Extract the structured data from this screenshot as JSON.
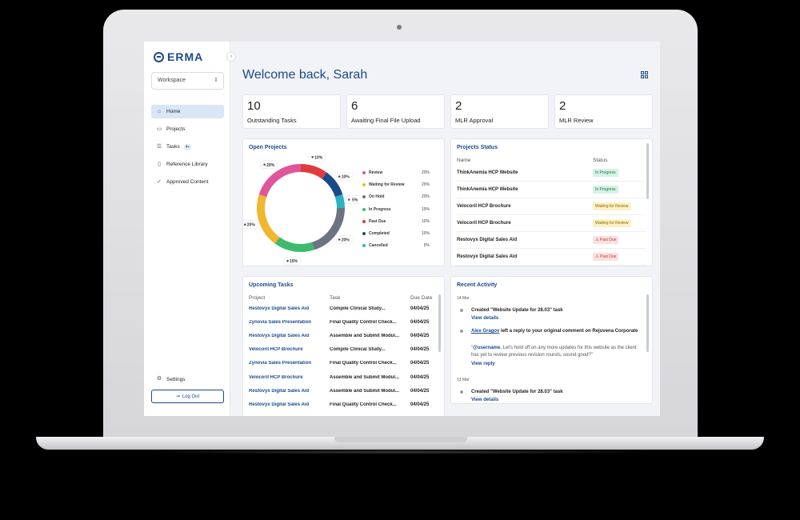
{
  "app": {
    "logo": "ERMA"
  },
  "sidebar": {
    "workspace_placeholder": "Workspace",
    "items": [
      {
        "label": "Home",
        "icon": "home-icon"
      },
      {
        "label": "Projects",
        "icon": "folder-icon"
      },
      {
        "label": "Tasks",
        "icon": "tasks-icon",
        "badge": "4+"
      },
      {
        "label": "Reference Library",
        "icon": "book-icon"
      },
      {
        "label": "Approved Content",
        "icon": "check-icon"
      }
    ],
    "settings_label": "Settings",
    "logout_label": "Log Out"
  },
  "header": {
    "welcome": "Welcome back, Sarah"
  },
  "stats": [
    {
      "value": "10",
      "label": "Outstanding Tasks"
    },
    {
      "value": "6",
      "label": "Awaiting Final File Upload"
    },
    {
      "value": "2",
      "label": "MLR Approval"
    },
    {
      "value": "2",
      "label": "MLR Review"
    }
  ],
  "open_projects": {
    "title": "Open Projects",
    "segments": [
      {
        "label": "Review",
        "value": 20,
        "pct": "20%",
        "color": "#e0569a"
      },
      {
        "label": "Waiting for Review",
        "value": 20,
        "pct": "20%",
        "color": "#f0b72f"
      },
      {
        "label": "On Hold",
        "value": 20,
        "pct": "20%",
        "color": "#6d7481"
      },
      {
        "label": "In Progress",
        "value": 15,
        "pct": "15%",
        "color": "#3dbb6b"
      },
      {
        "label": "Past Due",
        "value": 10,
        "pct": "10%",
        "color": "#e23b3b"
      },
      {
        "label": "Completed",
        "value": 10,
        "pct": "10%",
        "color": "#1b4a8a"
      },
      {
        "label": "Cancelled",
        "value": 5,
        "pct": "5%",
        "color": "#2bb3c0"
      }
    ],
    "donut_labels": [
      "10%",
      "10%",
      "5%",
      "20%",
      "15%",
      "20%",
      "20%"
    ]
  },
  "projects_status": {
    "title": "Projects Status",
    "col_name": "Name",
    "col_status": "Status",
    "rows": [
      {
        "name": "ThinkAnemia HCP Website",
        "status": "In Progress",
        "kind": "in-progress"
      },
      {
        "name": "ThinkAnemia HCP Website",
        "status": "In Progress",
        "kind": "in-progress"
      },
      {
        "name": "Velocoril HCP Brochure",
        "status": "Waiting for Review",
        "kind": "waiting"
      },
      {
        "name": "Velocoril HCP Brochure",
        "status": "Waiting for Review",
        "kind": "waiting"
      },
      {
        "name": "Restovyx Digital Sales Aid",
        "status": "Past Due",
        "kind": "past-due"
      },
      {
        "name": "Restovyx Digital Sales Aid",
        "status": "Past Due",
        "kind": "past-due"
      }
    ]
  },
  "upcoming_tasks": {
    "title": "Upcoming Tasks",
    "col_project": "Project",
    "col_task": "Task",
    "col_due": "Due Date",
    "rows": [
      {
        "project": "Restovyx Digital Sales Aid",
        "task": "Compile Clinical Study...",
        "due": "04/04/25"
      },
      {
        "project": "Zynovia Sales Presentation",
        "task": "Final Quality Control Check...",
        "due": "04/04/25"
      },
      {
        "project": "Restovyx Digital Sales Aid",
        "task": "Assemble and Submit Modul...",
        "due": "04/04/25"
      },
      {
        "project": "Velocoril HCP Brochure",
        "task": "Compile Clinical Study...",
        "due": "04/04/25"
      },
      {
        "project": "Zynovia Sales Presentation",
        "task": "Final Quality Control Check...",
        "due": "04/04/25"
      },
      {
        "project": "Velocoril HCP Brochure",
        "task": "Assemble and Submit Modul...",
        "due": "04/04/25"
      },
      {
        "project": "Restovyx Digital Sales Aid",
        "task": "Assemble and Submit Modul...",
        "due": "04/04/25"
      },
      {
        "project": "Restovyx Digital Sales Aid",
        "task": "Final Quality Control Check...",
        "due": "04/04/25"
      }
    ]
  },
  "recent_activity": {
    "title": "Recent Activity",
    "date1": "14 Mar",
    "item1_text": "Created \"Website Update for 28.03\" task",
    "item1_link": "View details",
    "item2_user": "Alex Gragov",
    "item2_text": " left a reply to your original comment on Rejuvena Corporate",
    "item2_mention": "@username",
    "item2_quote": ", Let's hold off on any more updates for this website as the client has yet to review previous revision rounds, sound good?\"",
    "item2_link": "View reply",
    "date2": "13 Mar",
    "item3_text": "Created \"Website Update for 28.03\" task",
    "item3_link": "View details"
  }
}
